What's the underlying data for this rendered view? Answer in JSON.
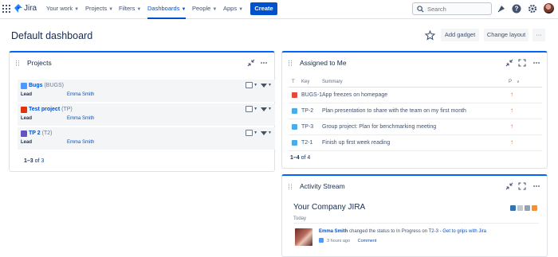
{
  "nav": {
    "brand": "Jira",
    "items": [
      {
        "label": "Your work",
        "has_chevron": true,
        "active": false
      },
      {
        "label": "Projects",
        "has_chevron": true,
        "active": false
      },
      {
        "label": "Filters",
        "has_chevron": true,
        "active": false
      },
      {
        "label": "Dashboards",
        "has_chevron": true,
        "active": true
      },
      {
        "label": "People",
        "has_chevron": true,
        "active": false
      },
      {
        "label": "Apps",
        "has_chevron": true,
        "active": false
      }
    ],
    "create_label": "Create",
    "search_placeholder": "Search",
    "icons": [
      "notifications-icon",
      "help-icon",
      "settings-icon",
      "profile-avatar"
    ]
  },
  "page": {
    "title": "Default dashboard",
    "add_gadget_label": "Add gadget",
    "change_layout_label": "Change layout",
    "more_label": "···"
  },
  "projects_gadget": {
    "title": "Projects",
    "rows": [
      {
        "name": "Bugs",
        "key": "(BUGS)",
        "lead_label": "Lead",
        "lead": "Emma Smith",
        "icon_color": "#4c9aff"
      },
      {
        "name": "Test project",
        "key": "(TP)",
        "lead_label": "Lead",
        "lead": "Emma Smith",
        "icon_color": "#de350b"
      },
      {
        "name": "TP 2",
        "key": "(T2)",
        "lead_label": "Lead",
        "lead": "Emma Smith",
        "icon_color": "#6554c0"
      }
    ],
    "pager_range": "1–3",
    "pager_of": "of",
    "pager_total": "3"
  },
  "assigned_gadget": {
    "title": "Assigned to Me",
    "columns": {
      "type": "T",
      "key": "Key",
      "summary": "Summary",
      "priority": "P"
    },
    "rows": [
      {
        "type": "bug",
        "key": "BUGS-1",
        "summary": "App freezes on homepage",
        "priority": "↑"
      },
      {
        "type": "task",
        "key": "TP-2",
        "summary": "Plan presentation to share with the team on my first month",
        "priority": "↑"
      },
      {
        "type": "task",
        "key": "TP-3",
        "summary": "Group project: Plan for benchmarking meeting",
        "priority": "↑"
      },
      {
        "type": "task",
        "key": "T2-1",
        "summary": "Finish up first week reading",
        "priority": "↑"
      }
    ],
    "count_range": "1–4",
    "count_of": "of 4"
  },
  "activity_gadget": {
    "title": "Activity Stream",
    "company": "Your Company JIRA",
    "today": "Today",
    "entry": {
      "user": "Emma Smith",
      "action": "changed the status to In Progress on",
      "link": "T2-3 - Get to grips with Jira",
      "time": "3 hours ago",
      "comment": "Comment"
    }
  },
  "colors": {
    "brand_blue": "#0052cc",
    "gadget_top": "#0065ff",
    "bug_red": "#e5493a",
    "task_blue": "#4bade8",
    "priority_high": "#ff5630"
  }
}
